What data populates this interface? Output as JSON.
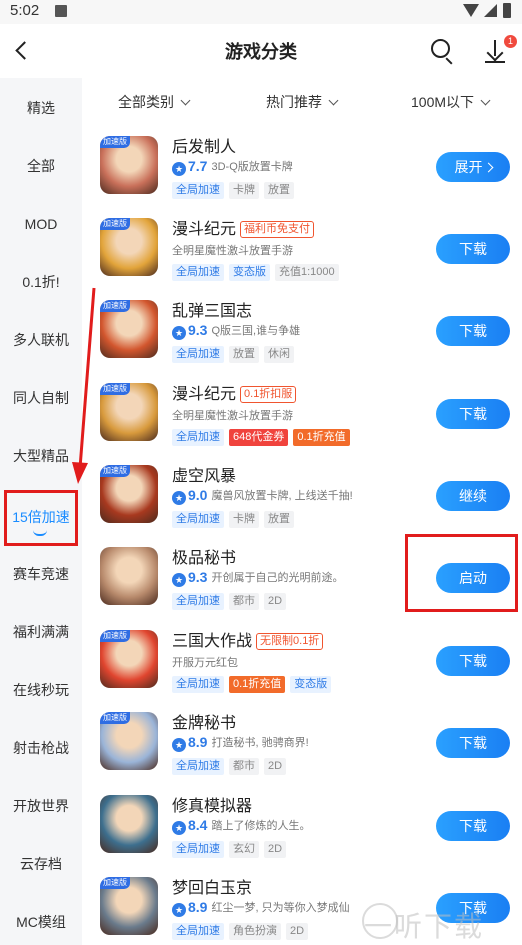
{
  "status_bar": {
    "time": "5:02"
  },
  "header": {
    "title": "游戏分类",
    "download_badge": "1"
  },
  "sidebar": {
    "items": [
      {
        "label": "精选"
      },
      {
        "label": "全部"
      },
      {
        "label": "MOD"
      },
      {
        "label": "0.1折!"
      },
      {
        "label": "多人联机"
      },
      {
        "label": "同人自制"
      },
      {
        "label": "大型精品"
      },
      {
        "label": "15倍加速",
        "active": true
      },
      {
        "label": "赛车竞速"
      },
      {
        "label": "福利满满"
      },
      {
        "label": "在线秒玩"
      },
      {
        "label": "射击枪战"
      },
      {
        "label": "开放世界"
      },
      {
        "label": "云存档"
      },
      {
        "label": "MC模组"
      }
    ]
  },
  "filters": [
    {
      "label": "全部类别"
    },
    {
      "label": "热门推荐"
    },
    {
      "label": "100M以下"
    }
  ],
  "games": [
    {
      "name": "后发制人",
      "name_tag": "",
      "score": "7.7",
      "desc": "3D-Q版放置卡牌",
      "tags": [
        [
          "全局加速",
          "blue"
        ],
        [
          "卡牌",
          "gray"
        ],
        [
          "放置",
          "gray"
        ]
      ],
      "button": "展开",
      "speed_tag": "加速版",
      "icon_color": "#c9705a"
    },
    {
      "name": "漫斗纪元",
      "name_tag": "福利币免支付",
      "score": "",
      "desc": "全明星魔性激斗放置手游",
      "tags": [
        [
          "全局加速",
          "blue"
        ],
        [
          "变态版",
          "blue"
        ],
        [
          "充值1:1000",
          "gray"
        ]
      ],
      "button": "下载",
      "speed_tag": "加速版",
      "icon_color": "#e2a43a"
    },
    {
      "name": "乱弹三国志",
      "name_tag": "",
      "score": "9.3",
      "desc": "Q版三国,谁与争雄",
      "tags": [
        [
          "全局加速",
          "blue"
        ],
        [
          "放置",
          "gray"
        ],
        [
          "休闲",
          "gray"
        ]
      ],
      "button": "下载",
      "speed_tag": "加速版",
      "icon_color": "#d2562e"
    },
    {
      "name": "漫斗纪元",
      "name_tag": "0.1折扣服",
      "score": "",
      "desc": "全明星魔性激斗放置手游",
      "tags": [
        [
          "全局加速",
          "blue"
        ],
        [
          "648代金券",
          "red"
        ],
        [
          "0.1折充值",
          "orange"
        ]
      ],
      "button": "下载",
      "speed_tag": "加速版",
      "icon_color": "#d89a3c"
    },
    {
      "name": "虚空风暴",
      "name_tag": "",
      "score": "9.0",
      "desc": "魔兽风放置卡牌, 上线送千抽!",
      "tags": [
        [
          "全局加速",
          "blue"
        ],
        [
          "卡牌",
          "gray"
        ],
        [
          "放置",
          "gray"
        ]
      ],
      "button": "继续",
      "speed_tag": "加速版",
      "icon_color": "#a8391f"
    },
    {
      "name": "极品秘书",
      "name_tag": "",
      "score": "9.3",
      "desc": "开创属于自己的光明前途。",
      "tags": [
        [
          "全局加速",
          "blue"
        ],
        [
          "都市",
          "gray"
        ],
        [
          "2D",
          "gray"
        ]
      ],
      "button": "启动",
      "speed_tag": "",
      "icon_color": "#b88a6c"
    },
    {
      "name": "三国大作战",
      "name_tag": "无限制0.1折",
      "score": "",
      "desc": "开服万元红包",
      "tags": [
        [
          "全局加速",
          "blue"
        ],
        [
          "0.1折充值",
          "orange"
        ],
        [
          "变态版",
          "blue"
        ]
      ],
      "button": "下载",
      "speed_tag": "加速版",
      "icon_color": "#e0452f"
    },
    {
      "name": "金牌秘书",
      "name_tag": "",
      "score": "8.9",
      "desc": "打造秘书, 驰骋商界!",
      "tags": [
        [
          "全局加速",
          "blue"
        ],
        [
          "都市",
          "gray"
        ],
        [
          "2D",
          "gray"
        ]
      ],
      "button": "下载",
      "speed_tag": "加速版",
      "icon_color": "#9ab4d8"
    },
    {
      "name": "修真模拟器",
      "name_tag": "",
      "score": "8.4",
      "desc": "踏上了修炼的人生。",
      "tags": [
        [
          "全局加速",
          "blue"
        ],
        [
          "玄幻",
          "gray"
        ],
        [
          "2D",
          "gray"
        ]
      ],
      "button": "下载",
      "speed_tag": "",
      "icon_color": "#3d6f8e"
    },
    {
      "name": "梦回白玉京",
      "name_tag": "",
      "score": "8.9",
      "desc": "红尘一梦, 只为等你入梦成仙",
      "tags": [
        [
          "全局加速",
          "blue"
        ],
        [
          "角色扮演",
          "gray"
        ],
        [
          "2D",
          "gray"
        ]
      ],
      "button": "下载",
      "speed_tag": "加速版",
      "icon_color": "#6a7b8c"
    }
  ],
  "watermark": "一听下载"
}
